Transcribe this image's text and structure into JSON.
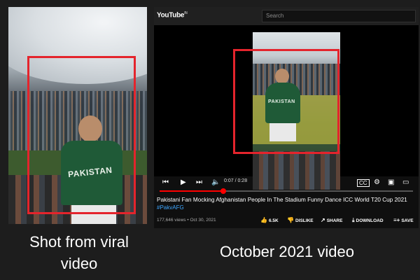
{
  "captions": {
    "left": "Shot from viral video",
    "right": "October 2021 video"
  },
  "youtube": {
    "logo": "YouTube",
    "logo_region": "IN",
    "search_placeholder": "Search",
    "time": "0:07 / 0:28",
    "progress_fraction": 0.25,
    "video_title": "Pakistani Fan Mocking Afghanistan People In The Stadium Funny Dance ICC World T20 Cup 2021",
    "hashtag": "#PakvAFG",
    "views_date": "177,646 views • Oct 30, 2021",
    "actions": {
      "like_count": "6.5K",
      "dislike_label": "DISLIKE",
      "share_label": "SHARE",
      "download_label": "DOWNLOAD",
      "save_label": "SAVE"
    },
    "icons": [
      "skip-back-icon",
      "play-icon",
      "skip-next-icon",
      "volume-icon",
      "subtitles-icon",
      "gear-icon",
      "miniplayer-icon",
      "theater-icon"
    ]
  },
  "shirt_text": "PAKISTAN",
  "colors": {
    "highlight": "#e4242c",
    "shirt": "#1f5a37",
    "progress": "#ff0000",
    "link": "#3ea6ff"
  }
}
